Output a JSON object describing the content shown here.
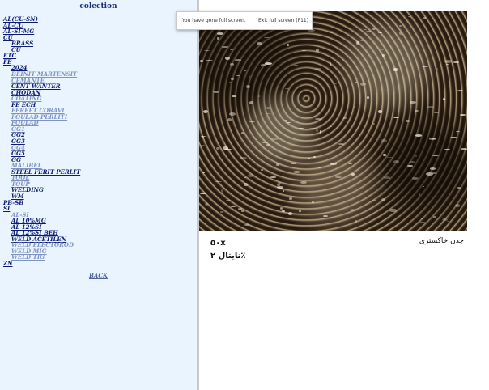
{
  "sidebar": {
    "title": "colection",
    "back_label": "BACK",
    "items": [
      {
        "label": "AL(CU-SN)",
        "tone": "dark",
        "indent": 0
      },
      {
        "label": "AL-CU",
        "tone": "dark",
        "indent": 0
      },
      {
        "label": "AL-SI-MG",
        "tone": "dark",
        "indent": 0
      },
      {
        "label": "CU",
        "tone": "dark",
        "indent": 0
      },
      {
        "label": "BRASS",
        "tone": "dark",
        "indent": 1
      },
      {
        "label": "CU",
        "tone": "dark",
        "indent": 1
      },
      {
        "label": "ETC",
        "tone": "dark",
        "indent": 0
      },
      {
        "label": "FE",
        "tone": "dark",
        "indent": 0
      },
      {
        "label": "2024",
        "tone": "dark",
        "indent": 1
      },
      {
        "label": "BEINIT MARTENSIT",
        "tone": "light",
        "indent": 1
      },
      {
        "label": "CEMANTE",
        "tone": "light",
        "indent": 1
      },
      {
        "label": "CENT WANTER",
        "tone": "dark",
        "indent": 1
      },
      {
        "label": "CHODAN",
        "tone": "dark",
        "indent": 1
      },
      {
        "label": "COATING",
        "tone": "light",
        "indent": 1
      },
      {
        "label": "FE ECH",
        "tone": "dark",
        "indent": 1
      },
      {
        "label": "FEREET CORAVI",
        "tone": "light",
        "indent": 1
      },
      {
        "label": "FOULAD PERLITI",
        "tone": "light",
        "indent": 1
      },
      {
        "label": "FOULAD",
        "tone": "light",
        "indent": 1
      },
      {
        "label": "GG1",
        "tone": "light",
        "indent": 1
      },
      {
        "label": "GG2",
        "tone": "dark",
        "indent": 1
      },
      {
        "label": "GG3",
        "tone": "dark",
        "indent": 1
      },
      {
        "label": "GG4",
        "tone": "light",
        "indent": 1
      },
      {
        "label": "GG5",
        "tone": "dark",
        "indent": 1
      },
      {
        "label": "GG",
        "tone": "dark",
        "indent": 1
      },
      {
        "label": "MALIBEL",
        "tone": "light",
        "indent": 1
      },
      {
        "label": "STEEL FERIT PERLIT",
        "tone": "dark",
        "indent": 1
      },
      {
        "label": "TOOL",
        "tone": "light",
        "indent": 1
      },
      {
        "label": "TOUP",
        "tone": "light",
        "indent": 1
      },
      {
        "label": "WELDING",
        "tone": "dark",
        "indent": 1
      },
      {
        "label": "WM",
        "tone": "dark",
        "indent": 1
      },
      {
        "label": "PB-SB",
        "tone": "dark",
        "indent": 0
      },
      {
        "label": "SI",
        "tone": "dark",
        "indent": 0
      },
      {
        "label": "AL-SI",
        "tone": "light",
        "indent": 1
      },
      {
        "label": "AL 10%MG",
        "tone": "dark",
        "indent": 1
      },
      {
        "label": "AL 12%SI",
        "tone": "dark",
        "indent": 1
      },
      {
        "label": "AL 12%SI BEH",
        "tone": "dark",
        "indent": 1
      },
      {
        "label": "WELD ACETILEN",
        "tone": "dark",
        "indent": 1
      },
      {
        "label": "WELD ELECTOROD",
        "tone": "light",
        "indent": 1
      },
      {
        "label": "WELD MIG",
        "tone": "light",
        "indent": 1
      },
      {
        "label": "WELD TIG",
        "tone": "light",
        "indent": 1
      },
      {
        "label": "ZN",
        "tone": "dark",
        "indent": 0
      }
    ]
  },
  "content": {
    "magnification": "۵۰x",
    "etchant": "نایتال ۲٪",
    "material": "چدن خاکستری"
  },
  "fullscreen_notice": {
    "message": "You have gone full screen.",
    "exit_label": "Exit full screen (F11)"
  }
}
